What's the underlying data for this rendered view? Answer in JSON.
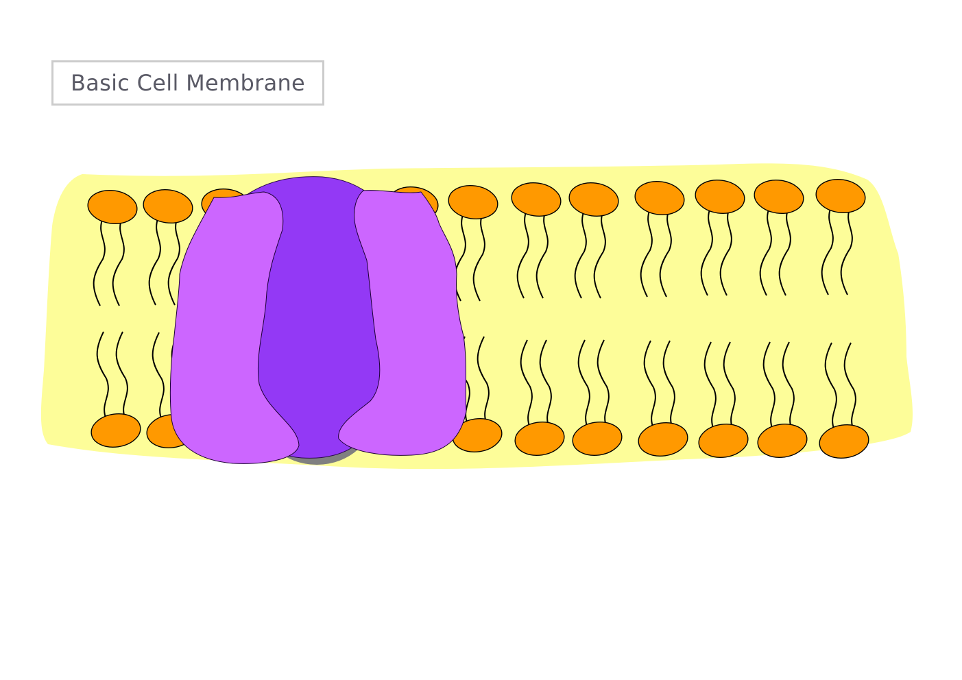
{
  "title": "Basic Cell Membrane",
  "colors": {
    "membrane_fill": "#fdfd99",
    "phosphate_head": "#ff9900",
    "outline": "#000000",
    "channel_core": "#9339f5",
    "channel_core_shadow": "#808080",
    "channel_sides": "#cc66ff"
  },
  "icons": {
    "phospholipid": "phospholipid-icon",
    "protein_channel": "protein-channel-icon"
  },
  "membrane": {
    "upper_leaflet_count": 14,
    "lower_leaflet_count": 14
  }
}
